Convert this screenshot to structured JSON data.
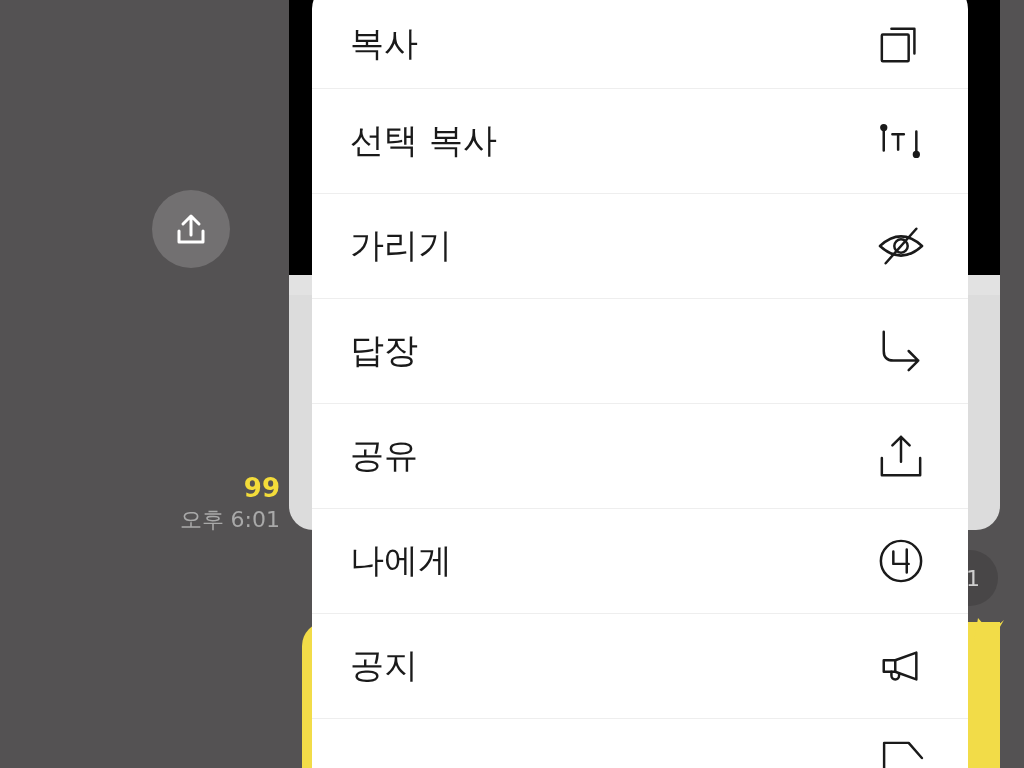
{
  "chat": {
    "message": {
      "kind": "picture",
      "unread_count": "99",
      "time": "오후 6:01"
    },
    "side_badge": "1"
  },
  "context_menu": {
    "items": [
      {
        "label": "복사",
        "kind": "copy"
      },
      {
        "label": "선택 복사",
        "kind": "select-copy"
      },
      {
        "label": "가리기",
        "kind": "hide"
      },
      {
        "label": "답장",
        "kind": "reply"
      },
      {
        "label": "공유",
        "kind": "share"
      },
      {
        "label": "나에게",
        "kind": "to-me"
      },
      {
        "label": "공지",
        "kind": "notice"
      },
      {
        "kind": "bookmark"
      }
    ]
  }
}
